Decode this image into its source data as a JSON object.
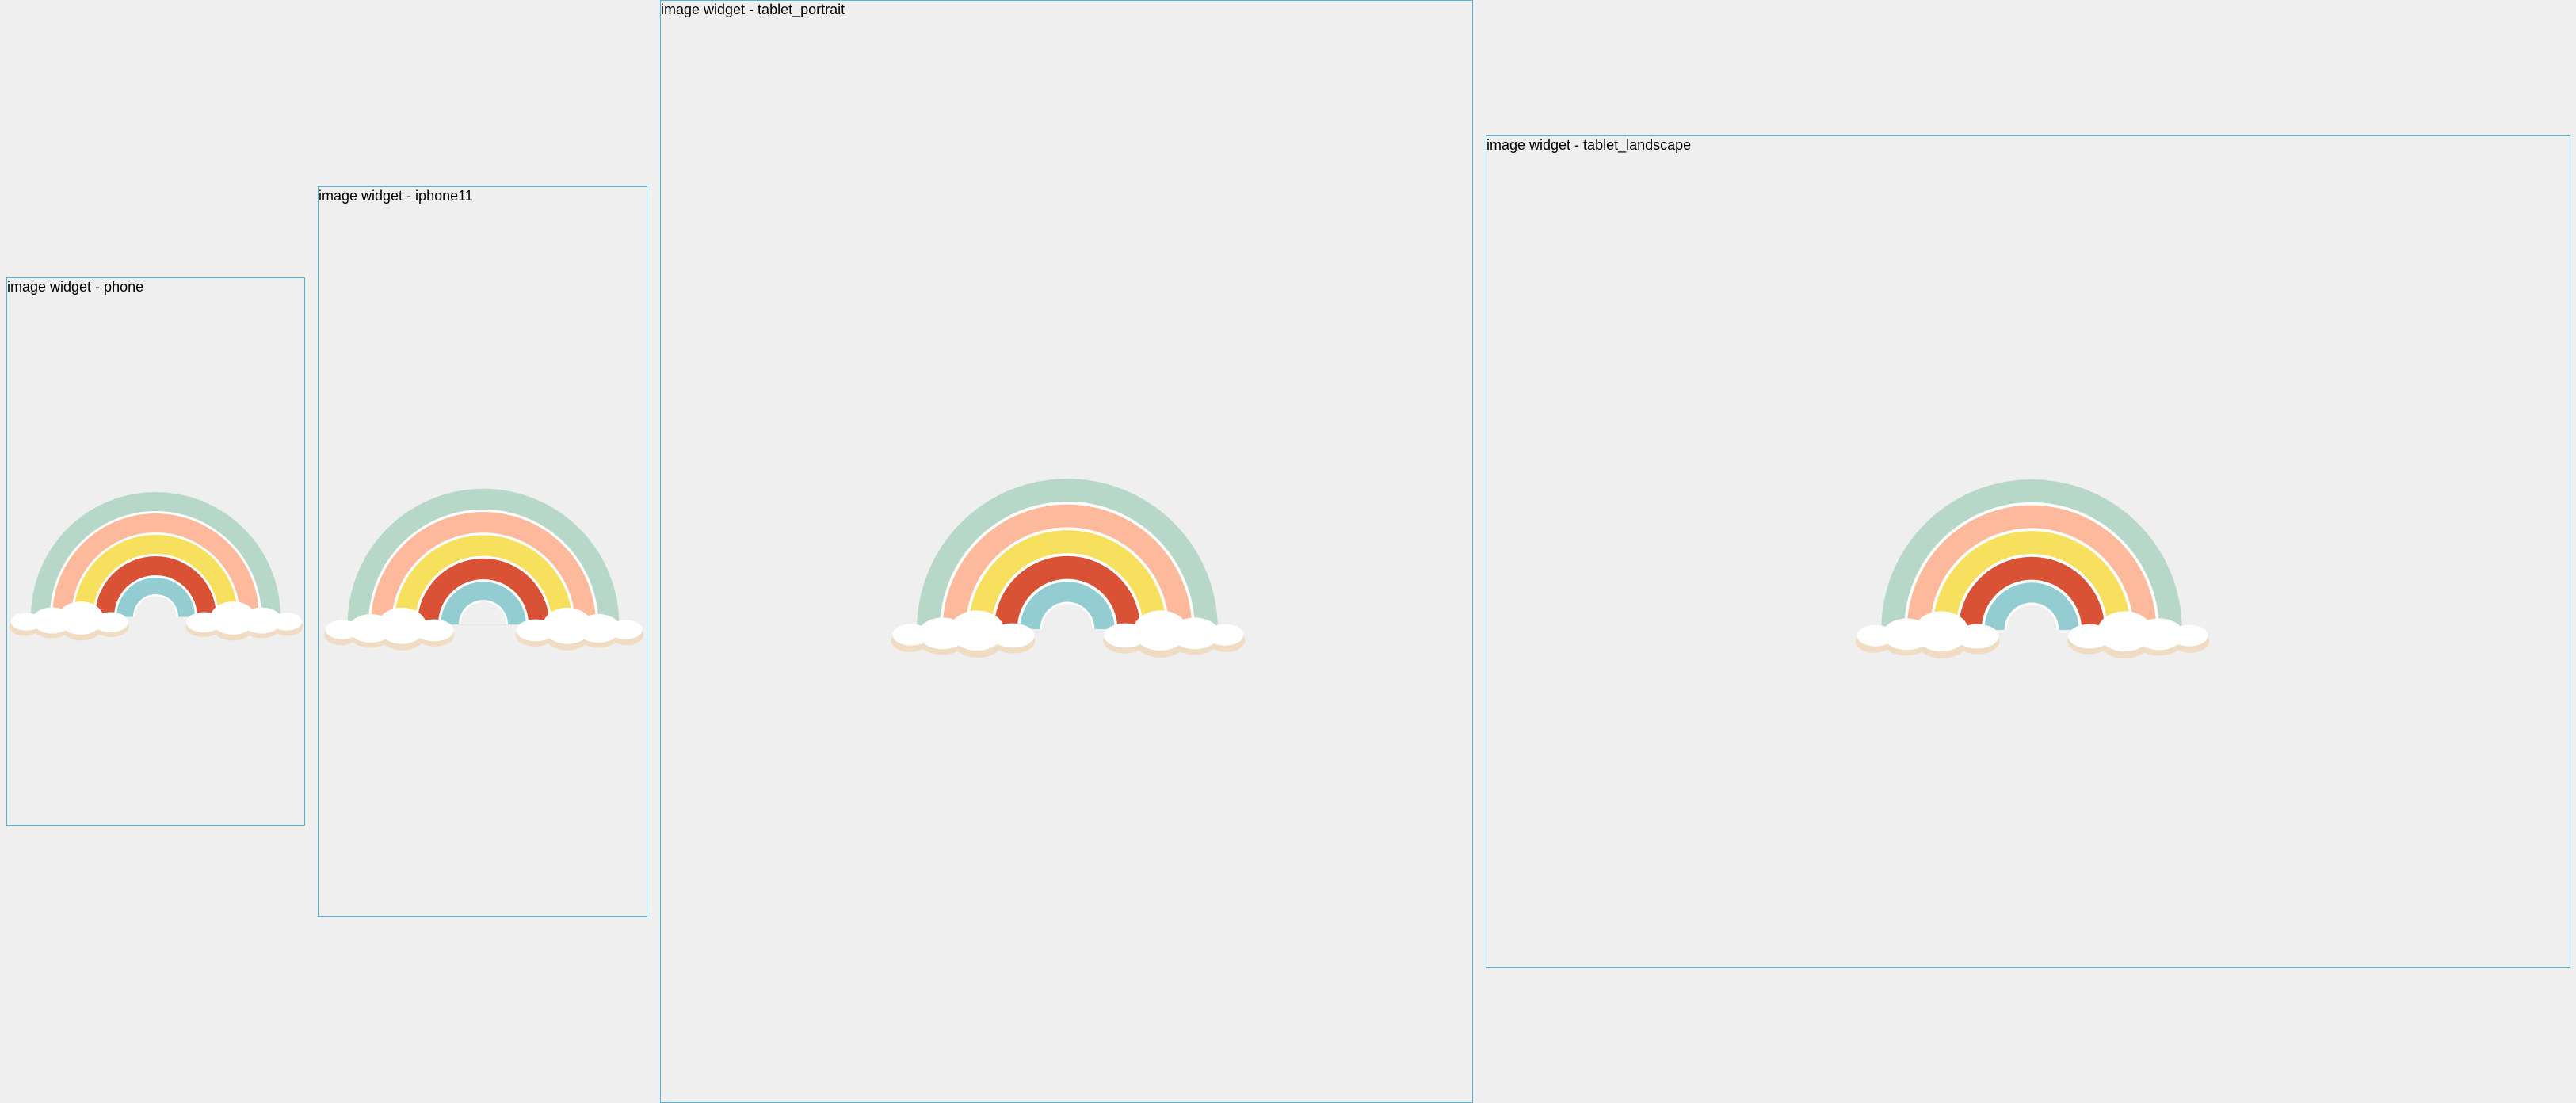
{
  "frames": [
    {
      "label": "image widget - phone"
    },
    {
      "label": "image widget - iphone11"
    },
    {
      "label": "image widget - tablet_portrait"
    },
    {
      "label": "image widget - tablet_landscape"
    }
  ],
  "colors": {
    "frame_border": "#4fb3e0",
    "background": "#efefef",
    "rainbow_band_1": "#b7d8c9",
    "rainbow_band_2": "#fdb99b",
    "rainbow_band_3": "#f6e05e",
    "rainbow_band_4": "#d95236",
    "rainbow_band_5": "#94cdd1",
    "cloud": "#ffffff",
    "cloud_shadow": "#f0dcc3"
  },
  "image": {
    "icon": "rainbow-with-clouds-image"
  }
}
